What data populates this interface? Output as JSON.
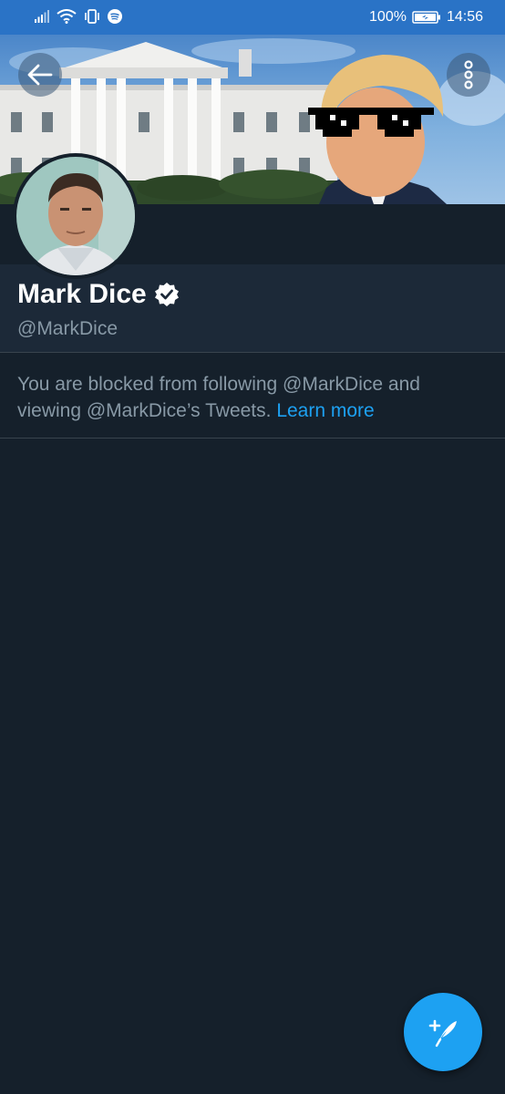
{
  "status_bar": {
    "battery_percent": "100%",
    "time": "14:56",
    "icons": [
      "signal-icon",
      "wifi-icon",
      "vibrate-icon",
      "spotify-icon",
      "battery-icon"
    ]
  },
  "header": {
    "back_icon": "arrow-left-icon",
    "more_icon": "more-vertical-icon"
  },
  "profile": {
    "display_name": "Mark Dice",
    "verified": true,
    "handle": "@MarkDice"
  },
  "blocked": {
    "message": "You are blocked from following @MarkDice and viewing @MarkDice’s Tweets.",
    "link_label": "Learn more"
  },
  "fab": {
    "icon": "compose-tweet-icon"
  },
  "colors": {
    "status_bar": "#2a73c6",
    "background": "#15202b",
    "card": "#1c2938",
    "accent": "#1da1f2",
    "secondary_text": "#8899a6",
    "divider": "#38444d"
  }
}
